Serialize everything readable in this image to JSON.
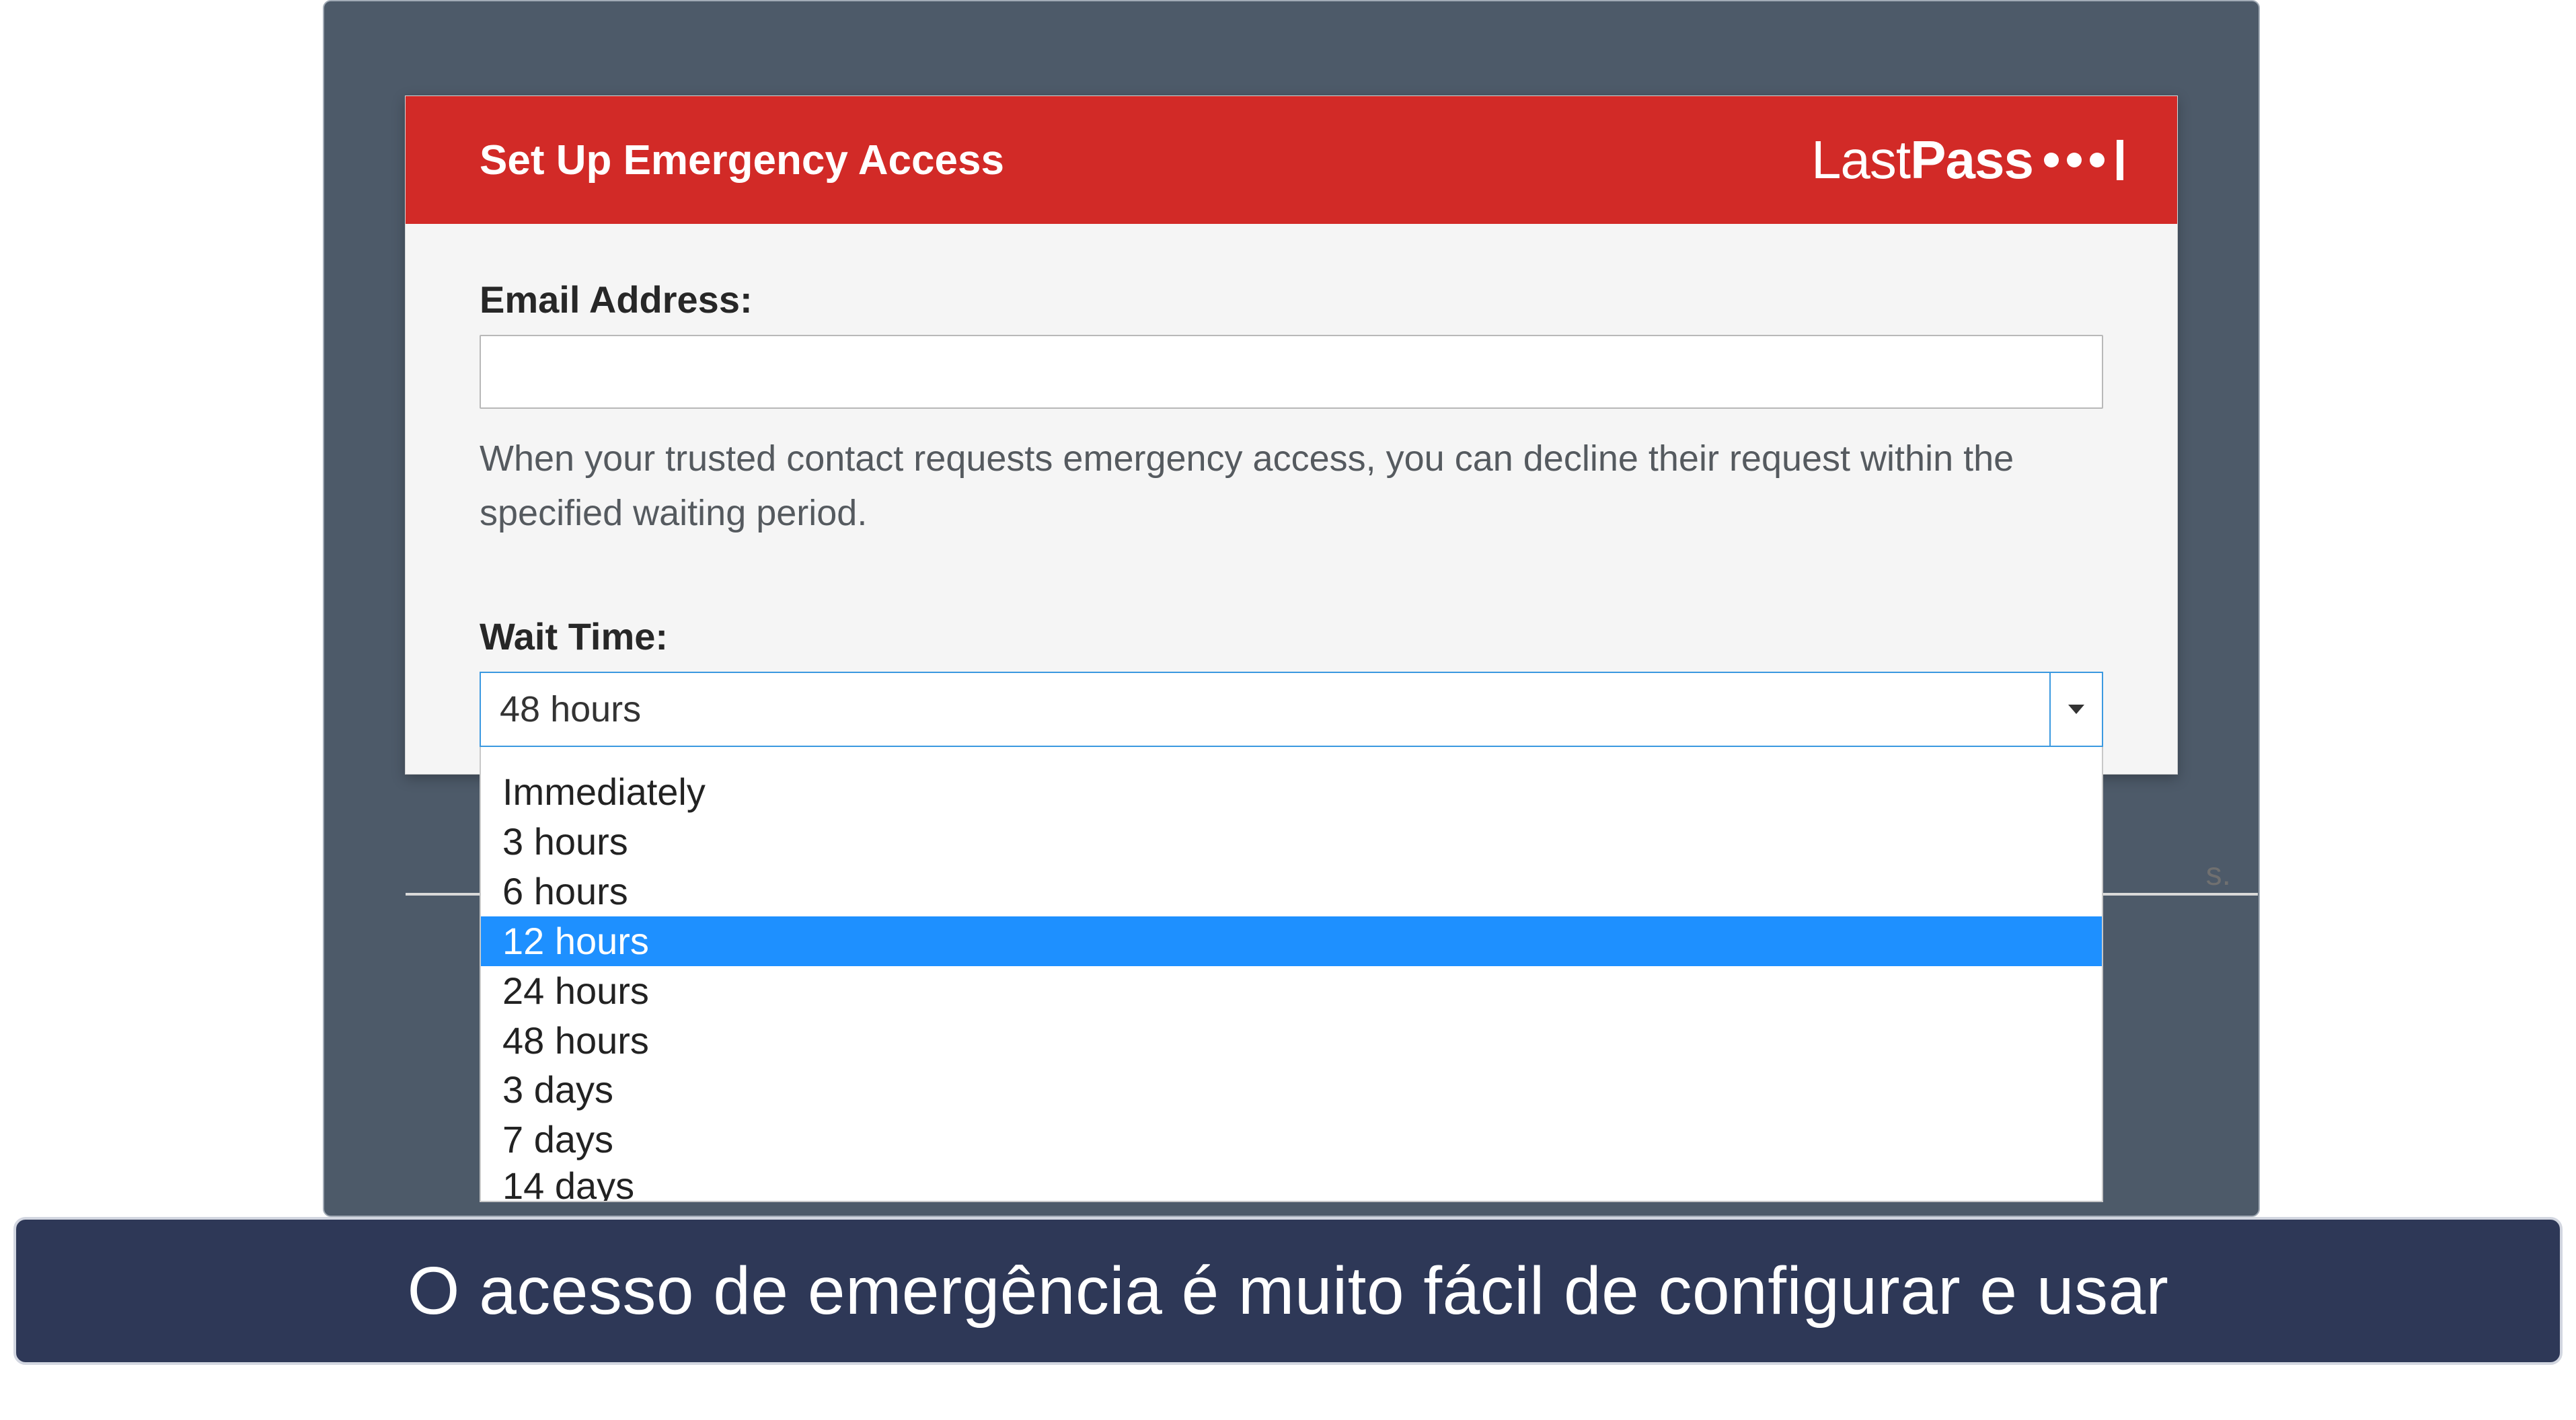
{
  "dialog": {
    "title": "Set Up Emergency Access",
    "brand": "LastPass"
  },
  "form": {
    "email_label": "Email Address:",
    "email_value": "",
    "help_text": "When your trusted contact requests emergency access, you can decline their request within the specified waiting period.",
    "wait_label": "Wait Time:",
    "wait_selected": "48 hours",
    "wait_options": [
      "Immediately",
      "3 hours",
      "6 hours",
      "12 hours",
      "24 hours",
      "48 hours",
      "3 days",
      "7 days",
      "14 days"
    ],
    "wait_highlight_index": 3
  },
  "background_fragment": "s.",
  "caption": "O acesso de emergência é muito fácil de configurar e usar",
  "colors": {
    "header_red": "#d22a27",
    "frame_gray": "#4d5a69",
    "highlight_blue": "#1e90ff",
    "caption_navy": "#2e3857"
  }
}
